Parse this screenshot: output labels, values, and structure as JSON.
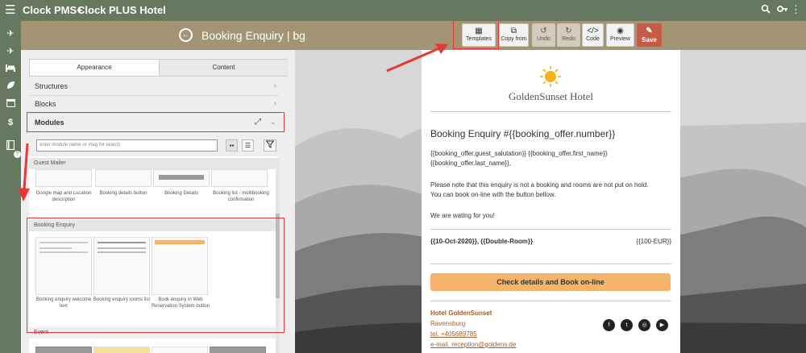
{
  "app": {
    "brand": "Clock PMS+",
    "hotel_name": "Clock PLUS Hotel"
  },
  "colors": {
    "topbar": "#66785f",
    "header": "#a39474",
    "save": "#c85a48",
    "cta": "#f5b46a",
    "link": "#a55e2a",
    "highlight": "#e53935"
  },
  "sidebar_icons": [
    "plane-arrival-icon",
    "plane-departure-icon",
    "bed-icon",
    "leaf-icon",
    "calendar-icon",
    "dollar-icon",
    "book-icon"
  ],
  "header": {
    "title": "Booking Enquiry | bg"
  },
  "toolbar": {
    "templates": "Templates",
    "copy_from": "Copy from",
    "undo": "Undo",
    "redo": "Redo",
    "code": "Code",
    "preview": "Preview",
    "save": "Save"
  },
  "panel": {
    "tabs": [
      "Appearance",
      "Content"
    ],
    "rows": [
      "Structures",
      "Blocks",
      "Modules"
    ],
    "search_placeholder": "enter module name or #tag for search",
    "sections": {
      "guest_mailer": {
        "label": "Guest Mailer",
        "items": [
          "Google map and Location description",
          "Booking details button",
          "Booking Details",
          "Booking list - multibooking confirmation"
        ]
      },
      "booking_enquiry": {
        "label": "Booking Enquiry",
        "items": [
          "Booking enquiry welcome text",
          "Booking enquiry rooms list",
          "Book enquiry in Web Reservation System button"
        ]
      },
      "event": {
        "label": "Event"
      }
    }
  },
  "email": {
    "logo_text": "GoldenSunset Hotel",
    "title": "Booking Enquiry #{{booking_offer.number}}",
    "salutation_1": "{{booking_offer.guest_salutation}} {{booking_offer.first_name}}",
    "salutation_2": "{{booking_offer.last_name}},",
    "note_1": "Please note that this enquiry is not a booking and rooms are not put on hold.",
    "note_2": "You can book on-line with the button bellow.",
    "waiting": "We are wating for you!",
    "room_line": "{{10-Oct-2020}}, {{Double-Room}}",
    "price": "{{100-EUR}}",
    "cta": "Check details and Book on-line",
    "hotel": "Hotel GoldenSunset",
    "city": "Ravensburg",
    "tel": "tel. +405689785",
    "email": "e-mail. reception@goldens.de",
    "social_icons": [
      "facebook-icon",
      "twitter-icon",
      "instagram-icon",
      "youtube-icon"
    ]
  }
}
